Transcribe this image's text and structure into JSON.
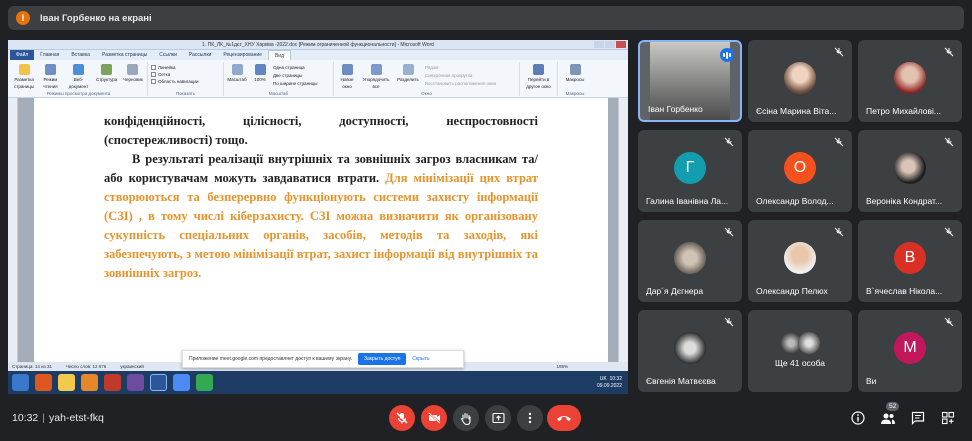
{
  "banner": {
    "initial": "І",
    "text": "Іван Горбенко на екрані"
  },
  "word": {
    "title": "1. ПК_ЛК_№1дєт_ХНУ Харківа -2022.doc [Режим ограниченной функциональности] - Microsoft Word",
    "tabs": [
      "Файл",
      "Главная",
      "Вставка",
      "Разметка страницы",
      "Ссылки",
      "Рассылки",
      "Рецензирование",
      "Вид"
    ],
    "ribbon": {
      "view_buttons": [
        "Разметка страницы",
        "Режим чтения",
        "Веб-документ",
        "Структура",
        "Черновик"
      ],
      "view_group": "Режимы просмотра документа",
      "show_checks": [
        "Линейка",
        "Сетка",
        "Область навигации"
      ],
      "show_group": "Показать",
      "zoom_buttons": [
        "Масштаб",
        "100%"
      ],
      "zoom_options": [
        "Одна страница",
        "Две страницы",
        "По ширине страницы"
      ],
      "zoom_group": "Масштаб",
      "window_buttons": [
        "Новое окно",
        "Упорядочить все",
        "Разделить"
      ],
      "window_options": [
        "Рядом",
        "Синхронная прокрутка",
        "Восстановить расположение окна"
      ],
      "window_group": "Окно",
      "switch_button": "Перейти в другое окно",
      "macros_button": "Макросы",
      "macros_group": "Макросы"
    },
    "doc": {
      "line1": "конфіденційності, цілісності, доступності, неспростовності (спостережливості) тощо.",
      "p2_black": "В результаті реалізації внутрішніх та зовнішніх загроз власникам та/або користувачам можуть завдаватися втрати.",
      "p2_orange": "Для мінімізації цих втрат створюються та безперервно функціонують системи захисту інформації (СЗІ) , в тому числі кіберзахисту.  СЗІ можна визначити як організовану сукупність спеціальних органів, засобів, методів та заходів, які забезпечують, з метою мінімізації втрат, захист інформації від внутрішніх та зовнішніх загроз."
    },
    "status": [
      "Страница: 14 из 31",
      "Число слов: 12 676",
      "украинский"
    ],
    "zoom_level": "198%",
    "notification": {
      "text": "Приложение meet.google.com предоставляет доступ к вашему экрану.",
      "stop": "Закрыть доступ",
      "hide": "Скрыть"
    },
    "tray": {
      "lang": "UK",
      "time": "10:32",
      "date": "09.09.2022"
    }
  },
  "participants": [
    {
      "name": "Іван Горбенко",
      "type": "video",
      "speaking": true
    },
    {
      "name": "Єсіна Марина Віта...",
      "type": "photo",
      "muted": true
    },
    {
      "name": "Петро Михайлові...",
      "type": "photo",
      "muted": true
    },
    {
      "name": "Галина Іванівна Ла...",
      "type": "initial",
      "initial": "Г",
      "color": "#129eaf",
      "muted": true
    },
    {
      "name": "Олександр Волод...",
      "type": "initial",
      "initial": "О",
      "color": "#f4511e",
      "muted": true
    },
    {
      "name": "Вероніка Кондрат...",
      "type": "photo",
      "muted": true
    },
    {
      "name": "Дар´я Дєгнера",
      "type": "photo",
      "muted": true
    },
    {
      "name": "Олександр Пелюх",
      "type": "photo",
      "muted": true
    },
    {
      "name": "В`ячеслав Ніколa...",
      "type": "initial",
      "initial": "В",
      "color": "#d93025",
      "muted": true
    },
    {
      "name": "Євгенія Матвєєва",
      "type": "photo",
      "muted": true
    },
    {
      "name": "Ще 41 особа",
      "type": "group",
      "muted": false
    },
    {
      "name": "Ви",
      "type": "initial",
      "initial": "М",
      "color": "#c2185b",
      "muted": true
    }
  ],
  "bottom": {
    "time": "10:32",
    "meeting_code": "yah-etst-fkq",
    "participant_count": "52"
  }
}
